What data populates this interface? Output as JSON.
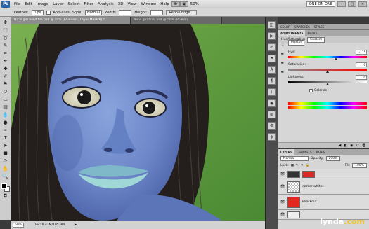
{
  "app": {
    "logo_text": "Ps",
    "menu": [
      "File",
      "Edit",
      "Image",
      "Layer",
      "Select",
      "Filter",
      "Analysis",
      "3D",
      "View",
      "Window",
      "Help"
    ],
    "menu_zoom": "50%",
    "workspace": "ONE-ON-ONE"
  },
  "options": {
    "feather_label": "Feather:",
    "feather_value": "0 px",
    "antialias_label": "Anti-alias",
    "style_label": "Style:",
    "style_value": "Normal",
    "width_label": "Width:",
    "height_label": "Height:",
    "refine_edge": "Refine Edge..."
  },
  "tabs": [
    {
      "label": "Na'vi girl build file.psd @ 50% (blueness, Layer Mask/8) *"
    },
    {
      "label": "Na'vi girl final.psd @ 50% (RGB/8)"
    }
  ],
  "status": {
    "zoom": "50%",
    "doc": "Doc: 6.43M/105.9M"
  },
  "adjustments": {
    "tabs": [
      "COLOR",
      "SWATCHES",
      "STYLES"
    ],
    "subtabs": [
      "ADJUSTMENTS",
      "MASKS"
    ],
    "title": "Hue/Saturation",
    "preset": "Custom",
    "channel": "Master",
    "hue_label": "Hue:",
    "hue_value": "-175",
    "saturation_label": "Saturation:",
    "saturation_value": "0",
    "lightness_label": "Lightness:",
    "lightness_value": "0",
    "colorize_label": "Colorize"
  },
  "layers": {
    "tabs": [
      "LAYERS",
      "CHANNELS",
      "PATHS"
    ],
    "blend_mode": "Normal",
    "opacity_label": "Opacity:",
    "opacity_value": "100%",
    "lock_label": "Lock:",
    "fill_label": "Fill:",
    "fill_value": "100%",
    "items": [
      {
        "name": "darker whites"
      },
      {
        "name": "knockout"
      }
    ]
  },
  "watermark": {
    "brand": "lynda",
    "dot": ".com"
  }
}
